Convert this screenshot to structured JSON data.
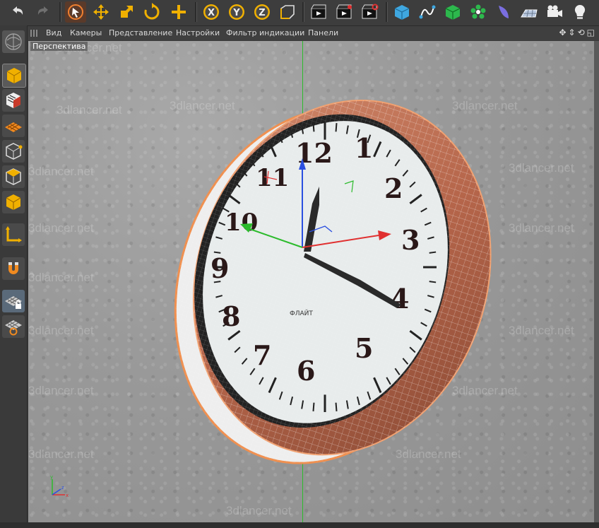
{
  "menu": {
    "items": [
      "Вид",
      "Камеры",
      "Представление",
      "Настройки",
      "Фильтр индикации",
      "Панели"
    ]
  },
  "viewport": {
    "label": "Перспектива",
    "watermark_text": "3dlancer.net"
  },
  "clock": {
    "numerals": [
      "12",
      "1",
      "2",
      "3",
      "4",
      "5",
      "6",
      "7",
      "8",
      "9",
      "10",
      "11"
    ],
    "brand": "ФЛАЙТ"
  },
  "toolbar": {
    "icons": [
      "undo-icon",
      "redo-icon",
      "select-arrow-icon",
      "move-icon",
      "scale-icon",
      "rotate-icon",
      "add-icon",
      "x-axis-lock-icon",
      "y-axis-lock-icon",
      "z-axis-lock-icon",
      "coordinate-system-icon",
      "render-view-icon",
      "render-picture-viewer-icon",
      "render-settings-icon",
      "cube-primitive-icon",
      "spline-icon",
      "nurbs-icon",
      "array-icon",
      "deformer-icon",
      "floor-icon",
      "camera-icon",
      "light-icon"
    ]
  },
  "left_toolbar": {
    "icons": [
      "model-mode-icon",
      "texture-mode-icon",
      "workplane-icon",
      "points-mode-icon",
      "edges-mode-icon",
      "polygons-mode-icon",
      "axis-mode-icon",
      "magnet-tool-icon",
      "snap-lock-icon",
      "snap-settings-icon"
    ]
  },
  "colors": {
    "accent_orange": "#f0b000",
    "x_axis": "#e03030",
    "y_axis": "#2cbb2c",
    "z_axis": "#2a4fe0",
    "frame_copper": "#b5654a"
  }
}
